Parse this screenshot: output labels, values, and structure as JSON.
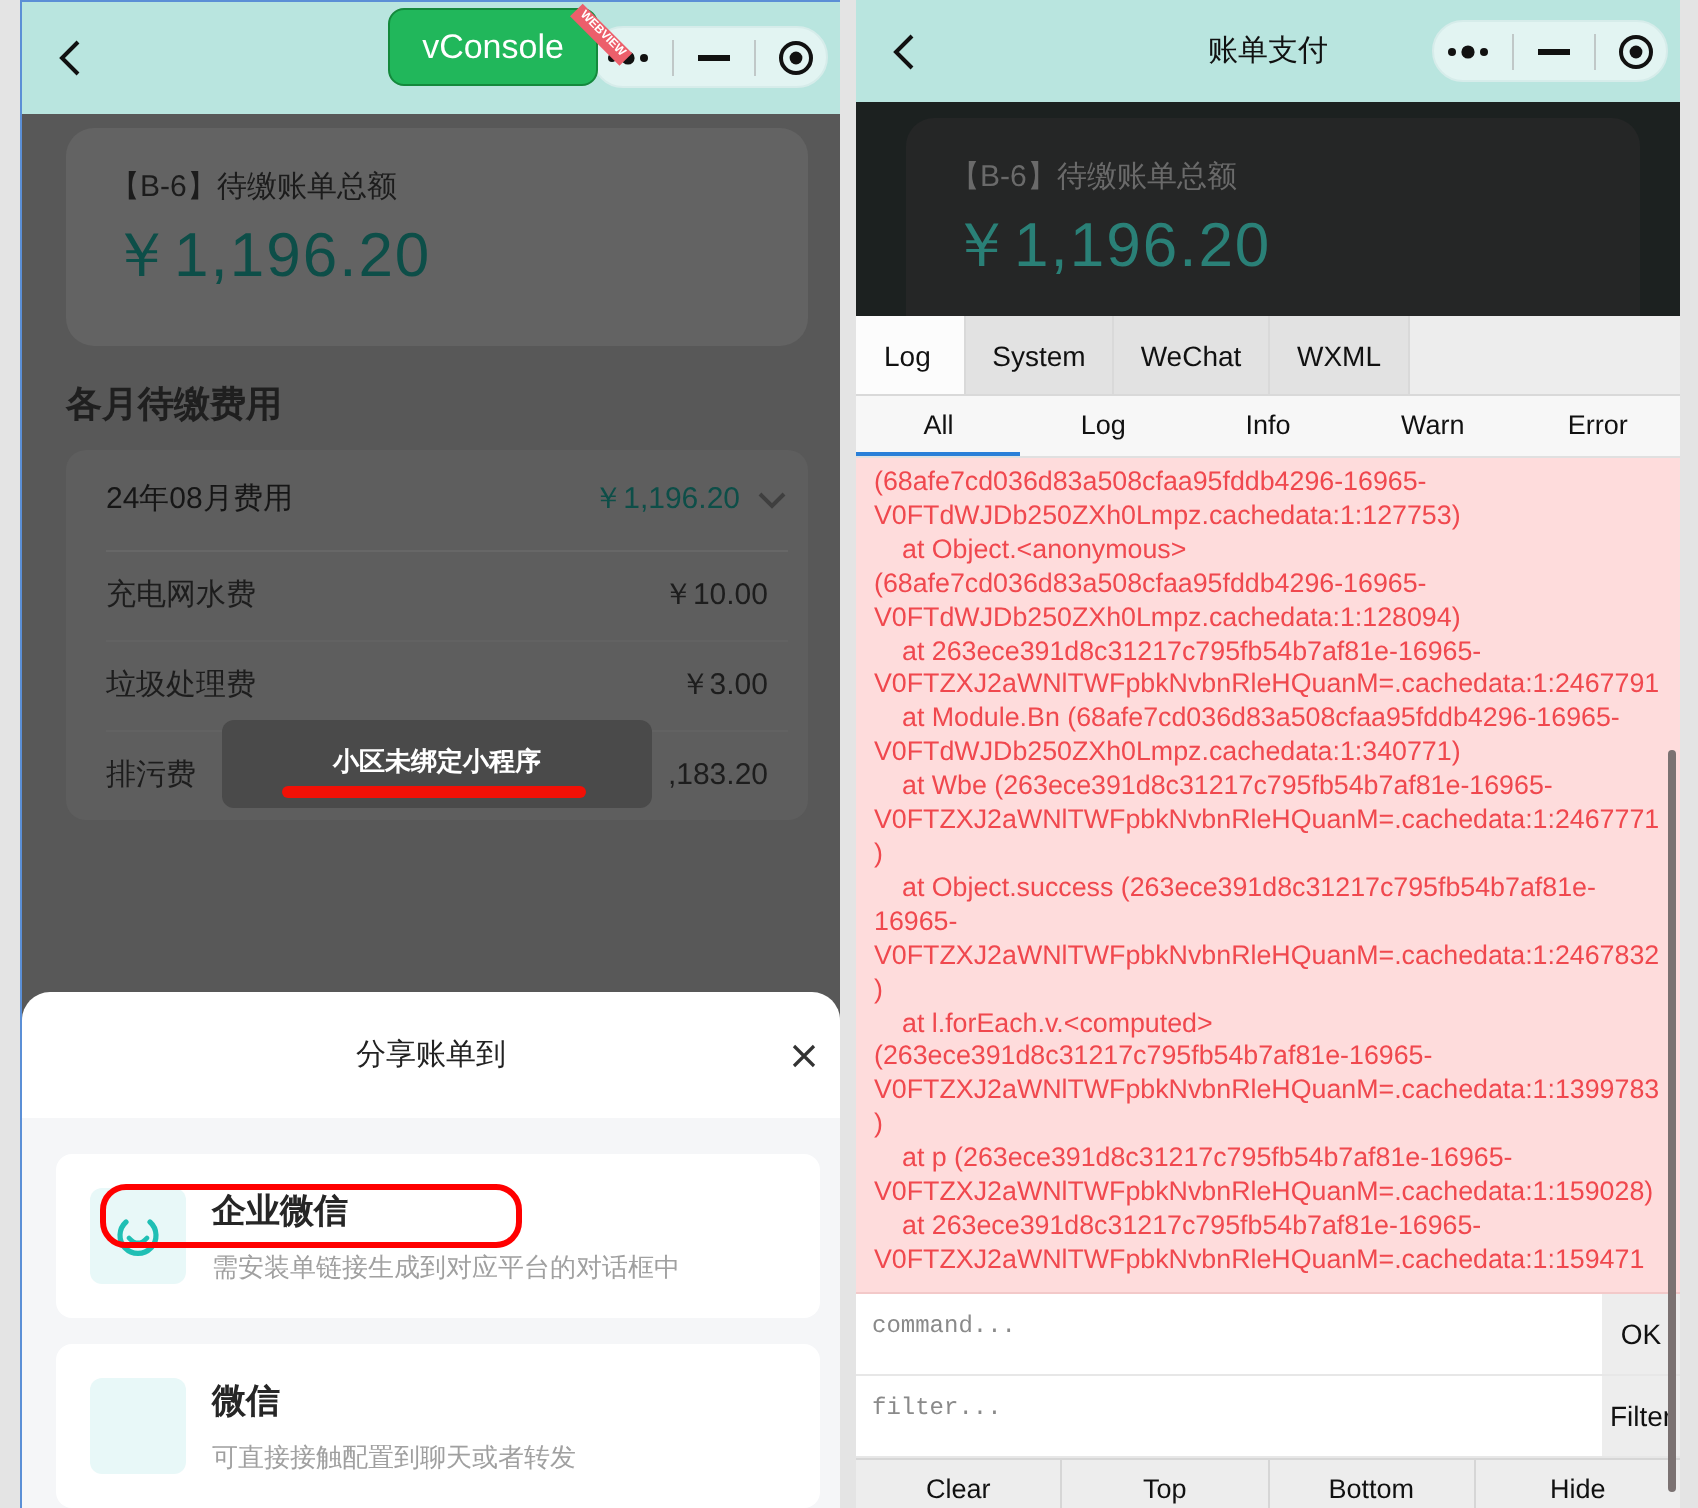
{
  "left_phone": {
    "nav": {
      "badge": {
        "label": "vConsole",
        "ribbon": "WEBVIEW"
      }
    },
    "summary": {
      "label": "【B-6】待缴账单总额",
      "amount": "￥1,196.20"
    },
    "section_title": "各月待缴费用",
    "month": {
      "label": "24年08月费用",
      "amount": "￥1,196.20",
      "expanded": true
    },
    "fees": [
      {
        "name": "充电网水费",
        "amount": "￥10.00"
      },
      {
        "name": "垃圾处理费",
        "amount": "￥3.00"
      },
      {
        "name": "排污费",
        "amount": ",183.20"
      }
    ],
    "toast": "小区未绑定小程序",
    "share_sheet": {
      "title": "分享账单到",
      "options": [
        {
          "kind": "wecom",
          "title": "企业微信",
          "desc": "需安装单链接生成到对应平台的对话框中",
          "highlighted": true
        },
        {
          "kind": "wechat",
          "title": "微信",
          "desc": "可直接接触配置到聊天或者转发",
          "highlighted": false
        }
      ]
    }
  },
  "right_phone": {
    "nav": {
      "title": "账单支付"
    },
    "summary": {
      "label": "【B-6】待缴账单总额",
      "amount": "￥1,196.20"
    },
    "console": {
      "tabs": [
        {
          "label": "Log",
          "selected": true
        },
        {
          "label": "System",
          "selected": false
        },
        {
          "label": "WeChat",
          "selected": false
        },
        {
          "label": "WXML",
          "selected": false
        }
      ],
      "filters": [
        {
          "label": "All",
          "selected": true
        },
        {
          "label": "Log",
          "selected": false
        },
        {
          "label": "Info",
          "selected": false
        },
        {
          "label": "Warn",
          "selected": false
        },
        {
          "label": "Error",
          "selected": false
        }
      ],
      "log_lines": [
        {
          "text": "(68afe7cd036d83a508cfaa95fddb4296-16965-",
          "indent": false
        },
        {
          "text": "V0FTdWJDb250ZXh0Lmpz.cachedata:1:127753)",
          "indent": false
        },
        {
          "text": "at Object.<anonymous>",
          "indent": true
        },
        {
          "text": "(68afe7cd036d83a508cfaa95fddb4296-16965-",
          "indent": false
        },
        {
          "text": "V0FTdWJDb250ZXh0Lmpz.cachedata:1:128094)",
          "indent": false
        },
        {
          "text": "at 263ece391d8c31217c795fb54b7af81e-16965-",
          "indent": true
        },
        {
          "text": "V0FTZXJ2aWNlTWFpbkNvbnRleHQuanM=.cachedata:1:2467791",
          "indent": false
        },
        {
          "text": "at Module.Bn (68afe7cd036d83a508cfaa95fddb4296-16965-",
          "indent": true
        },
        {
          "text": "V0FTdWJDb250ZXh0Lmpz.cachedata:1:340771)",
          "indent": false
        },
        {
          "text": "at Wbe (263ece391d8c31217c795fb54b7af81e-16965-",
          "indent": true
        },
        {
          "text": "V0FTZXJ2aWNlTWFpbkNvbnRleHQuanM=.cachedata:1:2467771",
          "indent": false
        },
        {
          "text": ")",
          "indent": false
        },
        {
          "text": "at Object.success (263ece391d8c31217c795fb54b7af81e-",
          "indent": true
        },
        {
          "text": "16965-",
          "indent": false
        },
        {
          "text": "V0FTZXJ2aWNlTWFpbkNvbnRleHQuanM=.cachedata:1:2467832",
          "indent": false
        },
        {
          "text": ")",
          "indent": false
        },
        {
          "text": "at l.forEach.v.<computed>",
          "indent": true
        },
        {
          "text": "(263ece391d8c31217c795fb54b7af81e-16965-",
          "indent": false
        },
        {
          "text": "V0FTZXJ2aWNlTWFpbkNvbnRleHQuanM=.cachedata:1:1399783",
          "indent": false
        },
        {
          "text": ")",
          "indent": false
        },
        {
          "text": "at p (263ece391d8c31217c795fb54b7af81e-16965-",
          "indent": true
        },
        {
          "text": "V0FTZXJ2aWNlTWFpbkNvbnRleHQuanM=.cachedata:1:159028)",
          "indent": false
        },
        {
          "text": "at 263ece391d8c31217c795fb54b7af81e-16965-",
          "indent": true
        },
        {
          "text": "V0FTZXJ2aWNlTWFpbkNvbnRleHQuanM=.cachedata:1:159471",
          "indent": false
        }
      ],
      "command": {
        "placeholder": "command...",
        "button": "OK"
      },
      "filter": {
        "placeholder": "filter...",
        "button": "Filter"
      },
      "toolbar": [
        "Clear",
        "Top",
        "Bottom",
        "Hide"
      ]
    }
  }
}
